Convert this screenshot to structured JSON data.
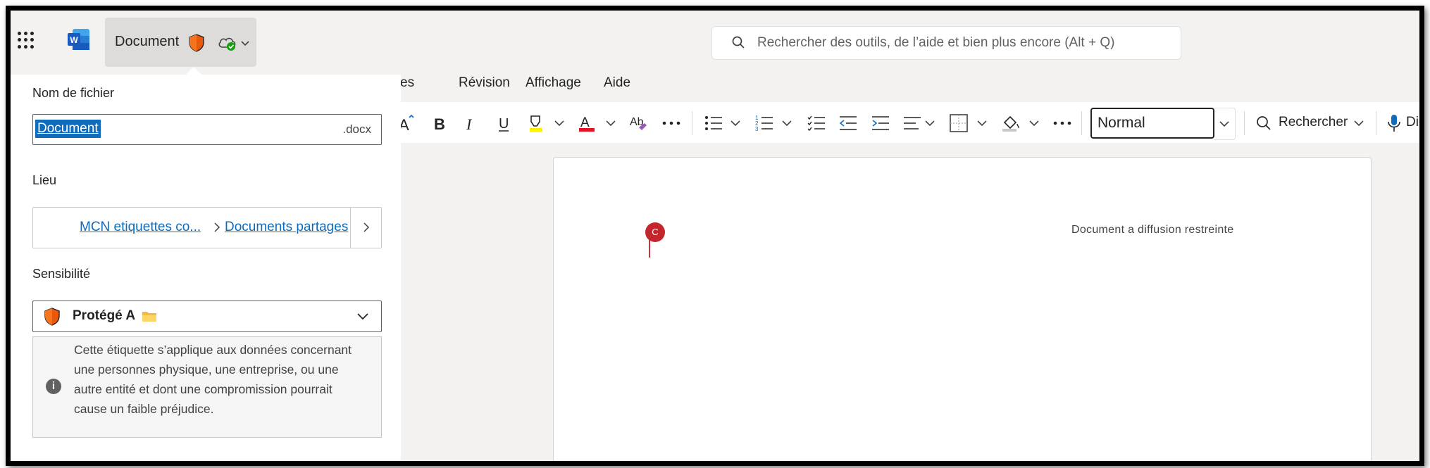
{
  "topbar": {
    "app_icon": "word-icon",
    "document_title": "Document",
    "search_placeholder": "Rechercher des outils, de l’aide et bien plus encore (Alt + Q)"
  },
  "menu": {
    "tabs": [
      {
        "label": "es"
      },
      {
        "label": "Révision"
      },
      {
        "label": "Affichage"
      },
      {
        "label": "Aide"
      }
    ]
  },
  "ribbon": {
    "style_value": "Normal",
    "find_label": "Rechercher",
    "dictate_label": "Dic",
    "icons": [
      "font-size-icon",
      "bold-icon",
      "italic-icon",
      "underline-icon",
      "highlight-icon",
      "font-color-icon",
      "format-painter-icon",
      "more-icon",
      "bullets-icon",
      "numbering-icon",
      "checklist-icon",
      "decrease-indent-icon",
      "increase-indent-icon",
      "align-icon",
      "borders-icon",
      "shading-icon",
      "more-icon",
      "search-icon",
      "microphone-icon"
    ]
  },
  "panel": {
    "filename_label": "Nom de fichier",
    "filename_value": "Document",
    "filename_ext": ".docx",
    "location_label": "Lieu",
    "location_site": "MCN etiquettes co...",
    "location_folder": "Documents partages",
    "sensitivity_label": "Sensibilité",
    "sensitivity_value": "Protégé A",
    "sensitivity_description": "Cette étiquette s’applique aux données concernant une personnes physique, une entreprise, ou une autre entité et dont une compromission pourrait cause un faible préjudice."
  },
  "document": {
    "header_text": "Document a diffusion restreinte",
    "coauthor_initial": "C"
  },
  "colors": {
    "accent": "#0f6cbd",
    "shield": "#e8590c",
    "cursor": "#c4262e"
  }
}
